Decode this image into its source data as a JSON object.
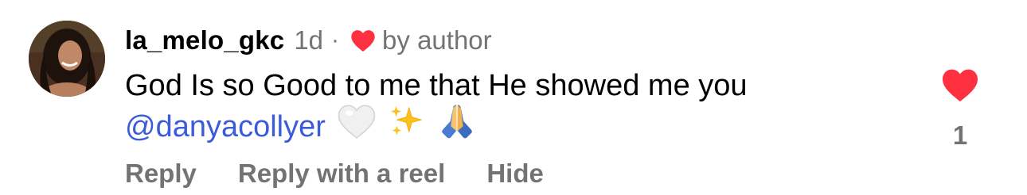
{
  "comment": {
    "username": "la_melo_gkc",
    "time": "1d",
    "separator": "·",
    "liked_by_author_label": "by author",
    "text_line1": "God Is so Good to me that He showed me you",
    "mention": "@danyacollyer",
    "emojis": [
      "white-heart",
      "sparkles",
      "folded-hands"
    ],
    "like_count": "1",
    "like_color": "#ff3040"
  },
  "actions": {
    "reply": "Reply",
    "reply_with_reel": "Reply with a reel",
    "hide": "Hide"
  },
  "colors": {
    "mention": "#3b5bdb",
    "secondary_text": "#737373",
    "heart": "#ff3040"
  }
}
